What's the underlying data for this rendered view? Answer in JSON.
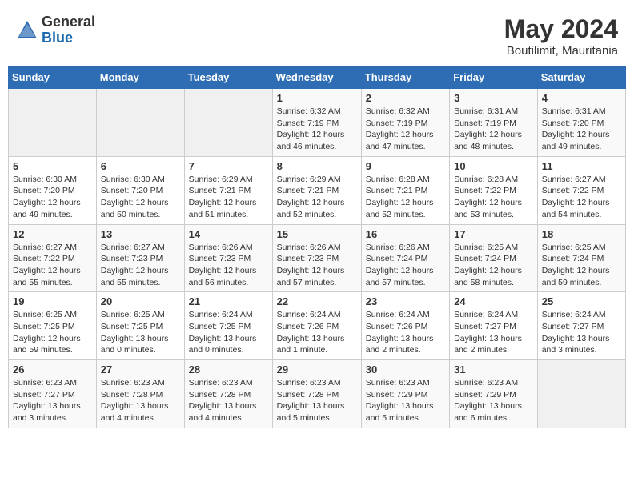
{
  "header": {
    "logo_general": "General",
    "logo_blue": "Blue",
    "month_year": "May 2024",
    "location": "Boutilimit, Mauritania"
  },
  "weekdays": [
    "Sunday",
    "Monday",
    "Tuesday",
    "Wednesday",
    "Thursday",
    "Friday",
    "Saturday"
  ],
  "weeks": [
    [
      {
        "day": "",
        "info": ""
      },
      {
        "day": "",
        "info": ""
      },
      {
        "day": "",
        "info": ""
      },
      {
        "day": "1",
        "info": "Sunrise: 6:32 AM\nSunset: 7:19 PM\nDaylight: 12 hours\nand 46 minutes."
      },
      {
        "day": "2",
        "info": "Sunrise: 6:32 AM\nSunset: 7:19 PM\nDaylight: 12 hours\nand 47 minutes."
      },
      {
        "day": "3",
        "info": "Sunrise: 6:31 AM\nSunset: 7:19 PM\nDaylight: 12 hours\nand 48 minutes."
      },
      {
        "day": "4",
        "info": "Sunrise: 6:31 AM\nSunset: 7:20 PM\nDaylight: 12 hours\nand 49 minutes."
      }
    ],
    [
      {
        "day": "5",
        "info": "Sunrise: 6:30 AM\nSunset: 7:20 PM\nDaylight: 12 hours\nand 49 minutes."
      },
      {
        "day": "6",
        "info": "Sunrise: 6:30 AM\nSunset: 7:20 PM\nDaylight: 12 hours\nand 50 minutes."
      },
      {
        "day": "7",
        "info": "Sunrise: 6:29 AM\nSunset: 7:21 PM\nDaylight: 12 hours\nand 51 minutes."
      },
      {
        "day": "8",
        "info": "Sunrise: 6:29 AM\nSunset: 7:21 PM\nDaylight: 12 hours\nand 52 minutes."
      },
      {
        "day": "9",
        "info": "Sunrise: 6:28 AM\nSunset: 7:21 PM\nDaylight: 12 hours\nand 52 minutes."
      },
      {
        "day": "10",
        "info": "Sunrise: 6:28 AM\nSunset: 7:22 PM\nDaylight: 12 hours\nand 53 minutes."
      },
      {
        "day": "11",
        "info": "Sunrise: 6:27 AM\nSunset: 7:22 PM\nDaylight: 12 hours\nand 54 minutes."
      }
    ],
    [
      {
        "day": "12",
        "info": "Sunrise: 6:27 AM\nSunset: 7:22 PM\nDaylight: 12 hours\nand 55 minutes."
      },
      {
        "day": "13",
        "info": "Sunrise: 6:27 AM\nSunset: 7:23 PM\nDaylight: 12 hours\nand 55 minutes."
      },
      {
        "day": "14",
        "info": "Sunrise: 6:26 AM\nSunset: 7:23 PM\nDaylight: 12 hours\nand 56 minutes."
      },
      {
        "day": "15",
        "info": "Sunrise: 6:26 AM\nSunset: 7:23 PM\nDaylight: 12 hours\nand 57 minutes."
      },
      {
        "day": "16",
        "info": "Sunrise: 6:26 AM\nSunset: 7:24 PM\nDaylight: 12 hours\nand 57 minutes."
      },
      {
        "day": "17",
        "info": "Sunrise: 6:25 AM\nSunset: 7:24 PM\nDaylight: 12 hours\nand 58 minutes."
      },
      {
        "day": "18",
        "info": "Sunrise: 6:25 AM\nSunset: 7:24 PM\nDaylight: 12 hours\nand 59 minutes."
      }
    ],
    [
      {
        "day": "19",
        "info": "Sunrise: 6:25 AM\nSunset: 7:25 PM\nDaylight: 12 hours\nand 59 minutes."
      },
      {
        "day": "20",
        "info": "Sunrise: 6:25 AM\nSunset: 7:25 PM\nDaylight: 13 hours\nand 0 minutes."
      },
      {
        "day": "21",
        "info": "Sunrise: 6:24 AM\nSunset: 7:25 PM\nDaylight: 13 hours\nand 0 minutes."
      },
      {
        "day": "22",
        "info": "Sunrise: 6:24 AM\nSunset: 7:26 PM\nDaylight: 13 hours\nand 1 minute."
      },
      {
        "day": "23",
        "info": "Sunrise: 6:24 AM\nSunset: 7:26 PM\nDaylight: 13 hours\nand 2 minutes."
      },
      {
        "day": "24",
        "info": "Sunrise: 6:24 AM\nSunset: 7:27 PM\nDaylight: 13 hours\nand 2 minutes."
      },
      {
        "day": "25",
        "info": "Sunrise: 6:24 AM\nSunset: 7:27 PM\nDaylight: 13 hours\nand 3 minutes."
      }
    ],
    [
      {
        "day": "26",
        "info": "Sunrise: 6:23 AM\nSunset: 7:27 PM\nDaylight: 13 hours\nand 3 minutes."
      },
      {
        "day": "27",
        "info": "Sunrise: 6:23 AM\nSunset: 7:28 PM\nDaylight: 13 hours\nand 4 minutes."
      },
      {
        "day": "28",
        "info": "Sunrise: 6:23 AM\nSunset: 7:28 PM\nDaylight: 13 hours\nand 4 minutes."
      },
      {
        "day": "29",
        "info": "Sunrise: 6:23 AM\nSunset: 7:28 PM\nDaylight: 13 hours\nand 5 minutes."
      },
      {
        "day": "30",
        "info": "Sunrise: 6:23 AM\nSunset: 7:29 PM\nDaylight: 13 hours\nand 5 minutes."
      },
      {
        "day": "31",
        "info": "Sunrise: 6:23 AM\nSunset: 7:29 PM\nDaylight: 13 hours\nand 6 minutes."
      },
      {
        "day": "",
        "info": ""
      }
    ]
  ]
}
